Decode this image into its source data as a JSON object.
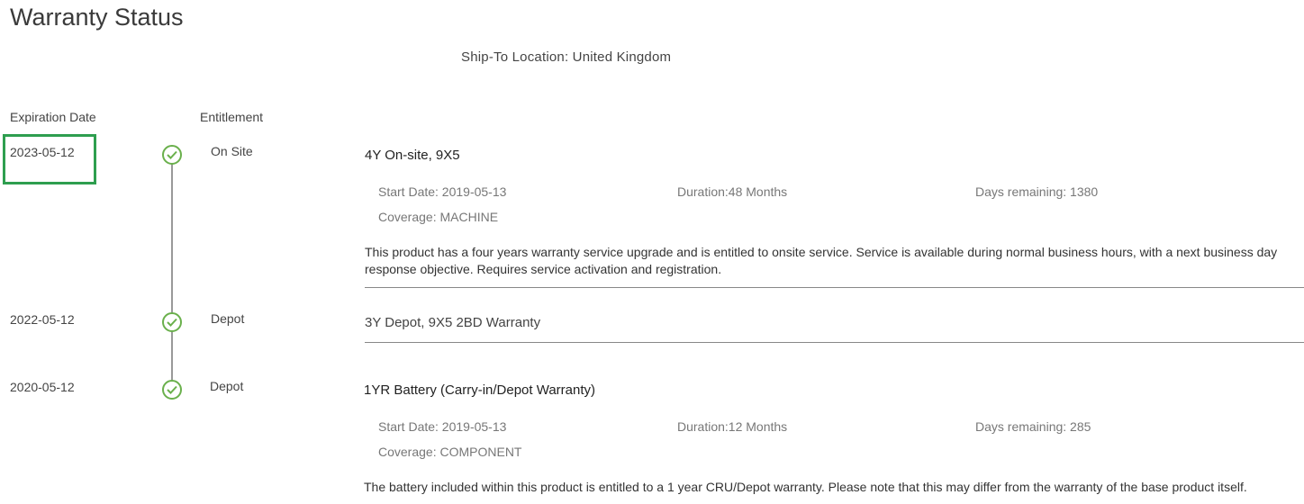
{
  "page": {
    "title": "Warranty Status",
    "ship_to": "Ship-To Location: United Kingdom"
  },
  "columns": {
    "expiration": "Expiration Date",
    "entitlement": "Entitlement"
  },
  "warranties": [
    {
      "expiration": "2023-05-12",
      "entitlement": "On Site",
      "name": "4Y On-site, 9X5",
      "start": "Start Date: 2019-05-13",
      "duration": "Duration:48 Months",
      "remaining": "Days remaining: 1380",
      "coverage": "Coverage: MACHINE",
      "description": "This product has a four years warranty service upgrade and is entitled to onsite service. Service is available during normal business hours, with a next business day response objective. Requires service activation and registration."
    },
    {
      "expiration": "2022-05-12",
      "entitlement": "Depot",
      "name": "3Y Depot, 9X5 2BD Warranty"
    },
    {
      "expiration": "2020-05-12",
      "entitlement": "Depot",
      "name": "1YR Battery (Carry-in/Depot Warranty)",
      "start": "Start Date: 2019-05-13",
      "duration": "Duration:12 Months",
      "remaining": "Days remaining: 285",
      "coverage": "Coverage: COMPONENT",
      "description": "The battery included within this product is entitled to a 1 year CRU/Depot warranty. Please note that this may differ from the warranty of the base product itself."
    }
  ],
  "colors": {
    "status_ok": "#6ab04c",
    "highlight": "#2e9e4f"
  },
  "icons": {
    "status": "check-circle-icon"
  }
}
